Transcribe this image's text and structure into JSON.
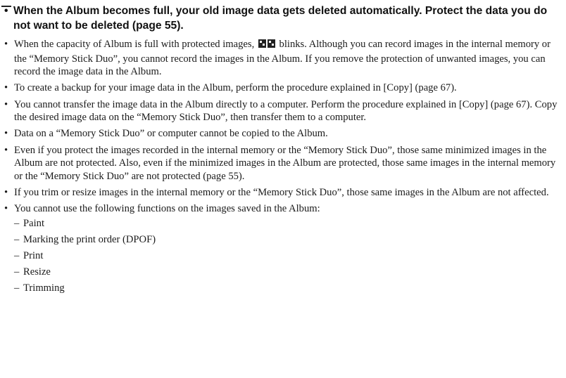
{
  "notice": {
    "bullet": "•",
    "text": "When the Album becomes full, your old image data gets deleted automatically. Protect the data you do not want to be deleted (page 55)."
  },
  "items": [
    {
      "bullet": "•",
      "text_before_icon": "When the capacity of Album is full with protected images, ",
      "icon": "album-icon",
      "text_after_icon": " blinks. Although you can record images in the internal memory or the “Memory Stick Duo”, you cannot record the images in the Album. If you remove the protection of unwanted images, you can record the image data in the Album."
    },
    {
      "bullet": "•",
      "text": "To create a backup for your image data in the Album, perform the procedure explained in [Copy] (page 67)."
    },
    {
      "bullet": "•",
      "text": "You cannot transfer the image data in the Album directly to a computer. Perform the procedure explained in [Copy] (page 67). Copy the desired image data on the “Memory Stick Duo”, then transfer them to a computer."
    },
    {
      "bullet": "•",
      "text": "Data on a “Memory Stick Duo” or computer cannot be copied to the Album."
    },
    {
      "bullet": "•",
      "text": "Even if you protect the images recorded in the internal memory or the “Memory Stick Duo”, those same minimized images in the Album are not protected. Also, even if the minimized images in the Album are protected, those same images in the internal memory or the “Memory Stick Duo” are not protected (page 55)."
    },
    {
      "bullet": "•",
      "text": "If you trim or resize images in the internal memory or the “Memory Stick Duo”, those same images in the Album are not affected."
    },
    {
      "bullet": "•",
      "text": "You cannot use the following functions on the images saved in the Album:"
    }
  ],
  "functions": {
    "dash": "–",
    "list": [
      "Paint",
      "Marking the print order (DPOF)",
      "Print",
      "Resize",
      "Trimming"
    ]
  }
}
